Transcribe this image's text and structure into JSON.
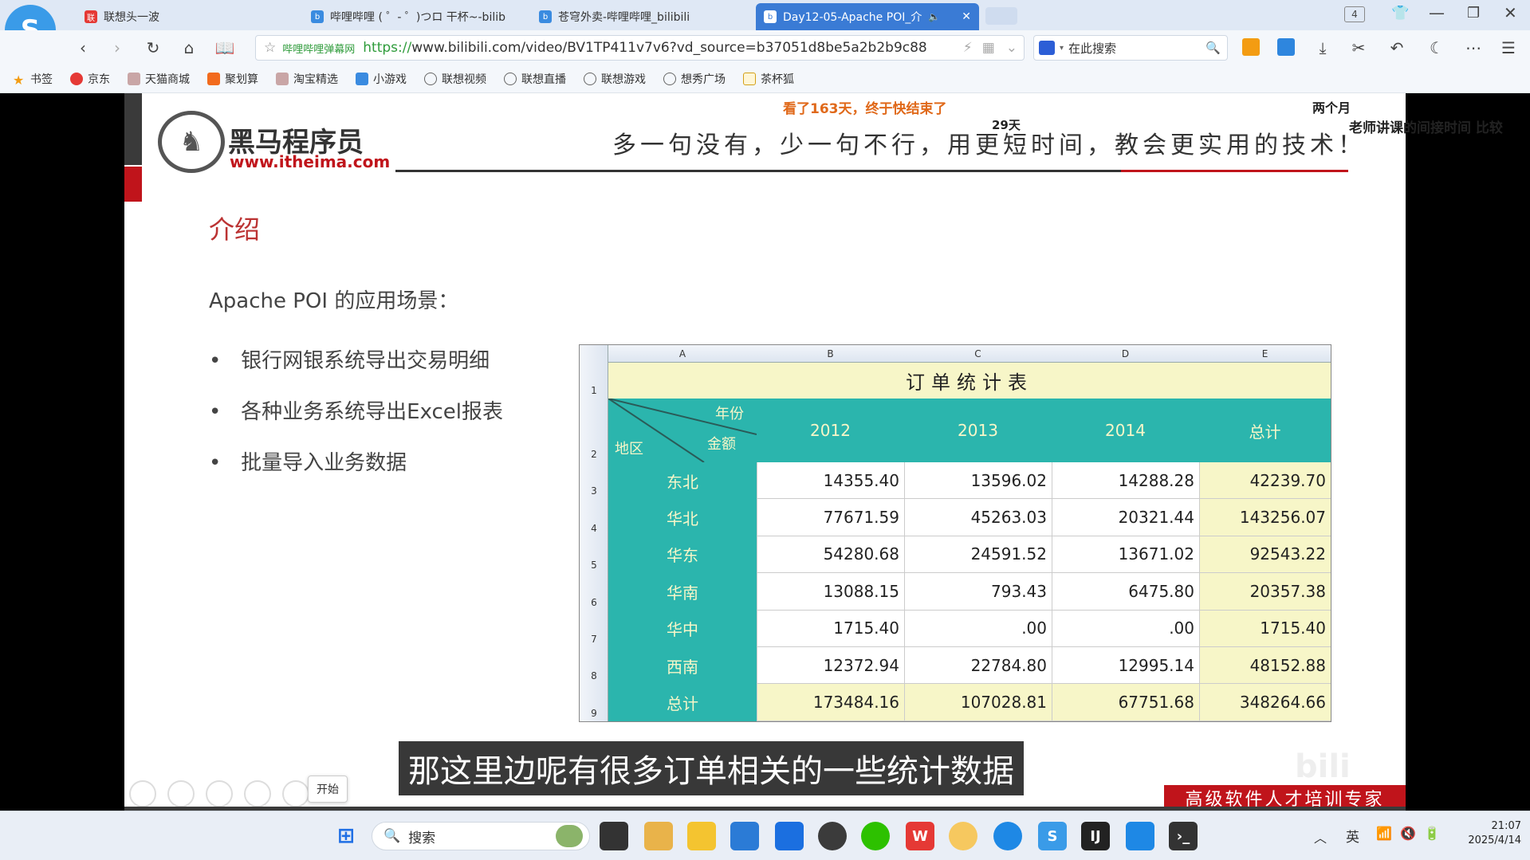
{
  "tabs": [
    {
      "label": "联想头一波",
      "color": "#e53935"
    },
    {
      "label": "哔哩哔哩 ( ゜- ゜)つロ 干杯~-bilib",
      "color": "#3a8be0"
    },
    {
      "label": "苍穹外卖-哔哩哔哩_bilibili",
      "color": "#3a8be0"
    },
    {
      "label": "Day12-05-Apache POI_介",
      "color": "#3a8be0",
      "active": true
    }
  ],
  "tab_count": "4",
  "address": {
    "site_label": "哔哩哔哩弹幕网",
    "proto": "https://",
    "url": "www.bilibili.com/video/BV1TP411v7v6?vd_source=b37051d8be5a2b2b9c88"
  },
  "search": {
    "placeholder": "在此搜索"
  },
  "bookmarks": [
    "书签",
    "京东",
    "天猫商城",
    "聚划算",
    "淘宝精选",
    "小游戏",
    "联想视频",
    "联想直播",
    "联想游戏",
    "想秀广场",
    "茶杯狐"
  ],
  "danmaku": [
    "看了163天，终于快结束了",
    "29天",
    "两个月",
    "老师讲课的间接时间  比较"
  ],
  "slide": {
    "brand_cn": "黑马程序员",
    "brand_url": "www.itheima.com",
    "slogan": "多一句没有，少一句不行，用更短时间，教会更实用的技术！",
    "heading": "介绍",
    "subtitle": "Apache POI 的应用场景：",
    "bullets": [
      "银行网银系统导出交易明细",
      "各种业务系统导出Excel报表",
      "批量导入业务数据"
    ],
    "footer_banner": "高级软件人才培训专家",
    "start_label": "开始"
  },
  "sheet": {
    "col_letters": [
      "A",
      "B",
      "C",
      "D",
      "E"
    ],
    "row_numbers": [
      "1",
      "2",
      "3",
      "4",
      "5",
      "6",
      "7",
      "8",
      "9"
    ],
    "title": "订单统计表",
    "diag_top": "年份",
    "diag_mid": "金额",
    "diag_bottom": "地区",
    "headers": [
      "2012",
      "2013",
      "2014",
      "总计"
    ],
    "rows": [
      {
        "region": "东北",
        "v": [
          "14355.40",
          "13596.02",
          "14288.28",
          "42239.70"
        ]
      },
      {
        "region": "华北",
        "v": [
          "77671.59",
          "45263.03",
          "20321.44",
          "143256.07"
        ]
      },
      {
        "region": "华东",
        "v": [
          "54280.68",
          "24591.52",
          "13671.02",
          "92543.22"
        ]
      },
      {
        "region": "华南",
        "v": [
          "13088.15",
          "793.43",
          "6475.80",
          "20357.38"
        ]
      },
      {
        "region": "华中",
        "v": [
          "1715.40",
          ".00",
          ".00",
          "1715.40"
        ]
      },
      {
        "region": "西南",
        "v": [
          "12372.94",
          "22784.80",
          "12995.14",
          "48152.88"
        ]
      },
      {
        "region": "总计",
        "v": [
          "173484.16",
          "107028.81",
          "67751.68",
          "348264.66"
        ]
      }
    ]
  },
  "caption": "那这里边呢有很多订单相关的一些统计数据",
  "taskbar": {
    "search": "搜索",
    "ime": "英",
    "time": "21:07",
    "date": "2025/4/14"
  },
  "colors": {
    "teal": "#2bb5ad",
    "cream": "#f7f6c8",
    "accent_red": "#c0392b"
  }
}
